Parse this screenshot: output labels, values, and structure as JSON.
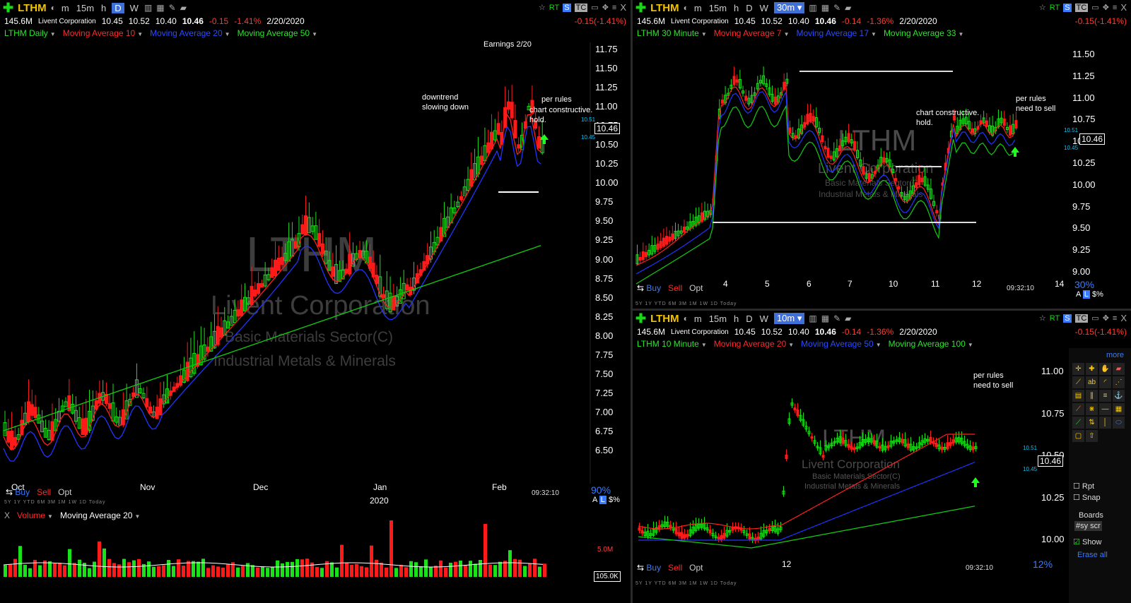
{
  "left_chart": {
    "symbol": "LTHM",
    "periods": [
      "m",
      "15m",
      "h",
      "D",
      "W"
    ],
    "selected_period": "D",
    "volume": "145.6M",
    "company": "Livent Corporation",
    "open": "10.45",
    "high": "10.52",
    "low": "10.40",
    "last": "10.46",
    "change": "-0.15",
    "change_pct": "-1.41%",
    "date": "2/20/2020",
    "change_summary": "-0.15(-1.41%)",
    "legend": [
      "LTHM Daily",
      "Moving Average 10",
      "Moving Average 20",
      "Moving Average 50"
    ],
    "watermark_symbol": "LTHM",
    "watermark_company": "Livent Corporation",
    "watermark_sector": "Basic Materials Sector(C)",
    "watermark_industry": "Industrial Metals & Minerals",
    "y_ticks": [
      "11.75",
      "11.50",
      "11.25",
      "11.00",
      "10.75",
      "10.50",
      "10.25",
      "10.00",
      "9.75",
      "9.50",
      "9.25",
      "9.00",
      "8.75",
      "8.50",
      "8.25",
      "8.00",
      "7.75",
      "7.50",
      "7.25",
      "7.00",
      "6.75",
      "6.50"
    ],
    "x_ticks": [
      "Oct",
      "Nov",
      "Dec",
      "Jan",
      "Feb"
    ],
    "year_label": "2020",
    "annotations": [
      "Earnings 2/20",
      "downtrend",
      "slowing down",
      "per rules",
      "chart constructive.",
      "hold."
    ],
    "price_tag": "10.46",
    "bid": "10.51",
    "ask": "10.45",
    "buy": "Buy",
    "sell": "Sell",
    "opt": "Opt",
    "clock": "09:32:10",
    "zoom": "90%",
    "scale_a": "A",
    "scale_l": "L",
    "scale_pct": "$%",
    "ranges": "5Y 1Y YTD 6M 3M 1M 1W 1D Today",
    "volume_legend": [
      "Volume",
      "Moving Average 20"
    ],
    "volume_ticks": [
      "5.0M",
      "105.0K"
    ]
  },
  "top_right": {
    "symbol": "LTHM",
    "periods": [
      "m",
      "15m",
      "h",
      "D",
      "W"
    ],
    "selected_period": "30m",
    "volume": "145.6M",
    "company": "Livent Corporation",
    "open": "10.45",
    "high": "10.52",
    "low": "10.40",
    "last": "10.46",
    "change": "-0.14",
    "change_pct": "-1.36%",
    "date": "2/20/2020",
    "change_summary": "-0.15(-1.41%)",
    "legend": [
      "LTHM 30 Minute",
      "Moving Average 7",
      "Moving Average 17",
      "Moving Average 33"
    ],
    "y_ticks": [
      "11.50",
      "11.25",
      "11.00",
      "10.75",
      "10.50",
      "10.25",
      "10.00",
      "9.75",
      "9.50",
      "9.25",
      "9.00"
    ],
    "x_ticks": [
      "4",
      "5",
      "6",
      "7",
      "10",
      "11",
      "12",
      "14"
    ],
    "annotations": [
      "chart constructive.",
      "hold.",
      "per rules",
      "need to sell"
    ],
    "price_tag": "10.46",
    "bid": "10.51",
    "ask": "10.45",
    "buy": "Buy",
    "sell": "Sell",
    "opt": "Opt",
    "clock": "09:32:10",
    "zoom": "30%",
    "ranges": "5Y 1Y YTD 6M 3M 1M 1W 1D Today"
  },
  "bottom_right": {
    "symbol": "LTHM",
    "periods": [
      "m",
      "15m",
      "h",
      "D",
      "W"
    ],
    "selected_period": "10m",
    "volume": "145.6M",
    "company": "Livent Corporation",
    "open": "10.45",
    "high": "10.52",
    "low": "10.40",
    "last": "10.46",
    "change": "-0.14",
    "change_pct": "-1.36%",
    "date": "2/20/2020",
    "change_summary": "-0.15(-1.41%)",
    "legend": [
      "LTHM 10 Minute",
      "Moving Average 20",
      "Moving Average 50",
      "Moving Average 100"
    ],
    "y_ticks": [
      "11.00",
      "10.75",
      "10.50",
      "10.25",
      "10.00"
    ],
    "x_ticks": [
      "12"
    ],
    "annotations": [
      "per rules",
      "need to sell"
    ],
    "price_tag": "10.46",
    "bid": "10.51",
    "ask": "10.45",
    "buy": "Buy",
    "sell": "Sell",
    "opt": "Opt",
    "clock": "09:32:10",
    "zoom": "12%",
    "ranges": "5Y 1Y YTD 6M 3M 1M 1W 1D Today"
  },
  "toolbox": {
    "more": "more",
    "rpt": "Rpt",
    "snap": "Snap",
    "boards": "Boards",
    "board_value": "#sy scr",
    "show": "Show",
    "erase_all": "Erase all"
  },
  "colors": {
    "up": "#19e219",
    "down": "#ff1a1a",
    "ma_short": "#ff2020",
    "ma_mid": "#2233ff",
    "ma_long": "#11cc11",
    "symbol": "#f4c400",
    "accent": "#3a7bff"
  }
}
